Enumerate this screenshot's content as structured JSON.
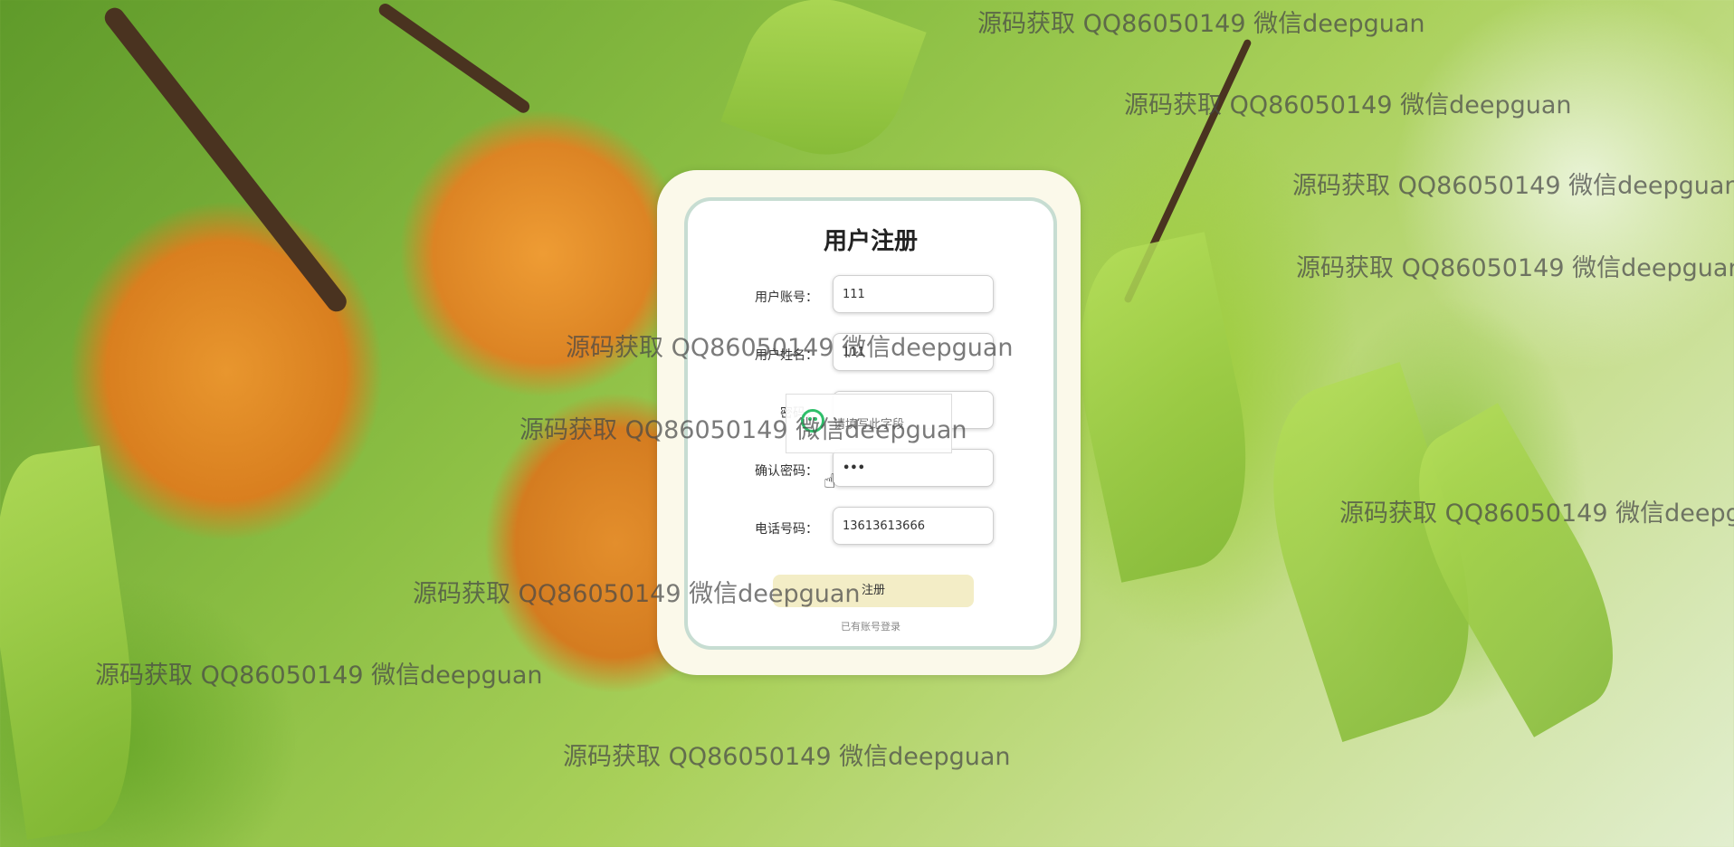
{
  "form": {
    "title": "用户注册",
    "fields": [
      {
        "label": "用户账号：",
        "value": "111"
      },
      {
        "label": "用户姓名：",
        "value": "111"
      },
      {
        "label": "密码：",
        "value": "•••"
      },
      {
        "label": "确认密码：",
        "value": "•••"
      },
      {
        "label": "电话号码：",
        "value": "13613613666"
      }
    ],
    "submit_label": "注册",
    "login_link": "已有账号登录"
  },
  "tooltip": {
    "text": "请填写此字段"
  },
  "watermark_text": "源码获取 QQ86050149 微信deepguan",
  "colors": {
    "card_bg": "#fbf9ea",
    "card_border": "#c7ddd2",
    "submit_bg": "#f3edc6",
    "tooltip_icon": "#2fbf6a"
  }
}
